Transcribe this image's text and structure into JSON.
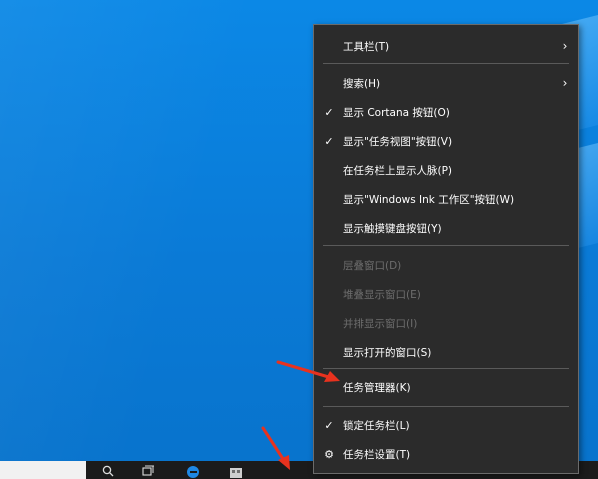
{
  "menu": {
    "items": [
      {
        "label": "工具栏(T)",
        "checked": false,
        "submenu": true,
        "disabled": false
      },
      {
        "label": "搜索(H)",
        "checked": false,
        "submenu": true,
        "disabled": false
      },
      {
        "label": "显示 Cortana 按钮(O)",
        "checked": true,
        "submenu": false,
        "disabled": false
      },
      {
        "label": "显示\"任务视图\"按钮(V)",
        "checked": true,
        "submenu": false,
        "disabled": false
      },
      {
        "label": "在任务栏上显示人脉(P)",
        "checked": false,
        "submenu": false,
        "disabled": false
      },
      {
        "label": "显示\"Windows Ink 工作区\"按钮(W)",
        "checked": false,
        "submenu": false,
        "disabled": false
      },
      {
        "label": "显示触摸键盘按钮(Y)",
        "checked": false,
        "submenu": false,
        "disabled": false
      },
      {
        "label": "层叠窗口(D)",
        "checked": false,
        "submenu": false,
        "disabled": true
      },
      {
        "label": "堆叠显示窗口(E)",
        "checked": false,
        "submenu": false,
        "disabled": true
      },
      {
        "label": "并排显示窗口(I)",
        "checked": false,
        "submenu": false,
        "disabled": true
      },
      {
        "label": "显示打开的窗口(S)",
        "checked": false,
        "submenu": false,
        "disabled": false
      },
      {
        "label": "任务管理器(K)",
        "checked": false,
        "submenu": false,
        "disabled": false
      },
      {
        "label": "锁定任务栏(L)",
        "checked": true,
        "submenu": false,
        "disabled": false
      },
      {
        "label": "任务栏设置(T)",
        "checked": false,
        "submenu": false,
        "disabled": false,
        "icon": "gear-icon"
      }
    ],
    "check_glyph": "✓",
    "chevron_glyph": "›",
    "gear_glyph": "⚙"
  },
  "taskbar": {
    "icons": [
      "search-icon",
      "task-view-icon",
      "edge-icon",
      "store-icon"
    ]
  },
  "colors": {
    "menu_bg": "#2b2b2b",
    "annotation_arrow": "#e8321e",
    "desktop": "#0a7fd8"
  }
}
